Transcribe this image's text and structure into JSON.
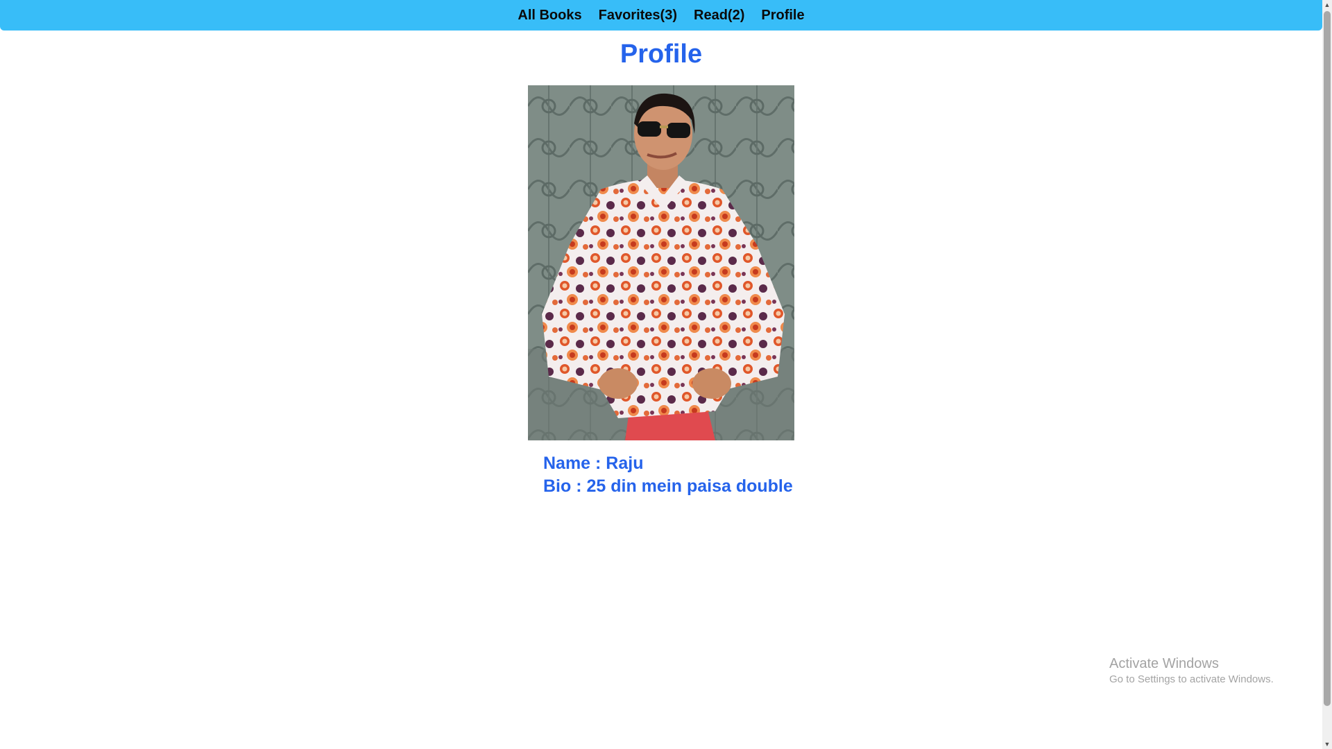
{
  "nav": {
    "items": [
      {
        "label": "All Books"
      },
      {
        "label": "Favorites(3)"
      },
      {
        "label": "Read(2)"
      },
      {
        "label": "Profile"
      }
    ]
  },
  "page": {
    "title": "Profile"
  },
  "profile": {
    "photo_icon": "profile-photo",
    "name_line": "Name : Raju",
    "bio_line": "Bio : 25 din mein paisa double"
  },
  "watermark": {
    "title": "Activate Windows",
    "subtitle": "Go to Settings to activate Windows."
  },
  "colors": {
    "navbar": "#38bdf8",
    "accent_text": "#2563eb"
  }
}
